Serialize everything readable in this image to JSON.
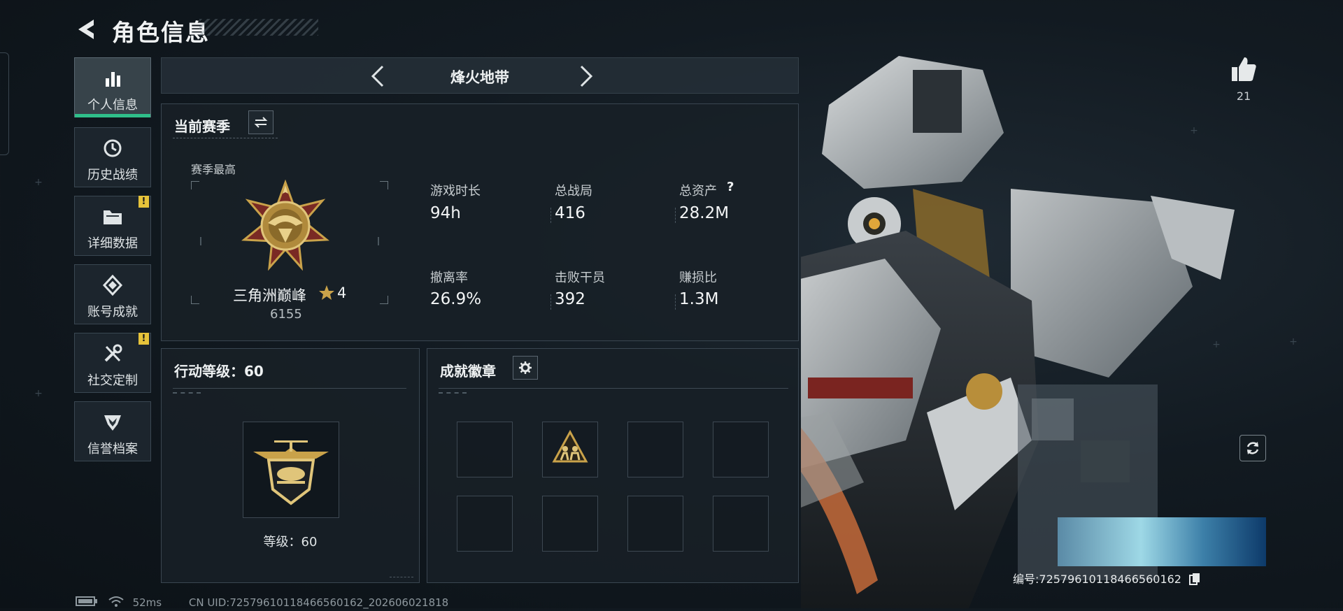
{
  "header": {
    "title": "角色信息"
  },
  "sidebar": {
    "items": [
      {
        "label": "个人信息",
        "icon": "bar-chart-icon",
        "active": true
      },
      {
        "label": "历史战绩",
        "icon": "history-clock-icon"
      },
      {
        "label": "详细数据",
        "icon": "folder-icon",
        "alert": "!"
      },
      {
        "label": "账号成就",
        "icon": "achievement-icon"
      },
      {
        "label": "社交定制",
        "icon": "tools-icon",
        "alert": "!"
      },
      {
        "label": "信誉档案",
        "icon": "shield-emblem-icon"
      }
    ]
  },
  "mode": {
    "title": "烽火地带"
  },
  "season": {
    "title": "当前赛季",
    "best_label": "赛季最高",
    "rank_name": "三角洲巅峰",
    "rank_stars": "4",
    "rank_score": "6155",
    "stats": [
      {
        "label": "游戏时长",
        "value": "94h"
      },
      {
        "label": "总战局",
        "value": "416"
      },
      {
        "label": "总资产",
        "value": "28.2M",
        "help": "?"
      },
      {
        "label": "撤离率",
        "value": "26.9%"
      },
      {
        "label": "击败干员",
        "value": "392"
      },
      {
        "label": "赚损比",
        "value": "1.3M"
      }
    ]
  },
  "action_level": {
    "title": "行动等级：60",
    "level_label": "等级：60"
  },
  "badges": {
    "title": "成就徽章",
    "slots_filled": [
      false,
      true,
      false,
      false,
      false,
      false,
      false,
      false
    ]
  },
  "social": {
    "likes": "21"
  },
  "player": {
    "id_text": "编号:7257961011846656016​2"
  },
  "footer": {
    "ping": "52ms",
    "uid_text": "CN UID:7257961011846656016​2_202606021818"
  },
  "colors": {
    "accent": "#2fbf8a",
    "warning": "#e6c33a",
    "gold": "#c9a24a"
  }
}
